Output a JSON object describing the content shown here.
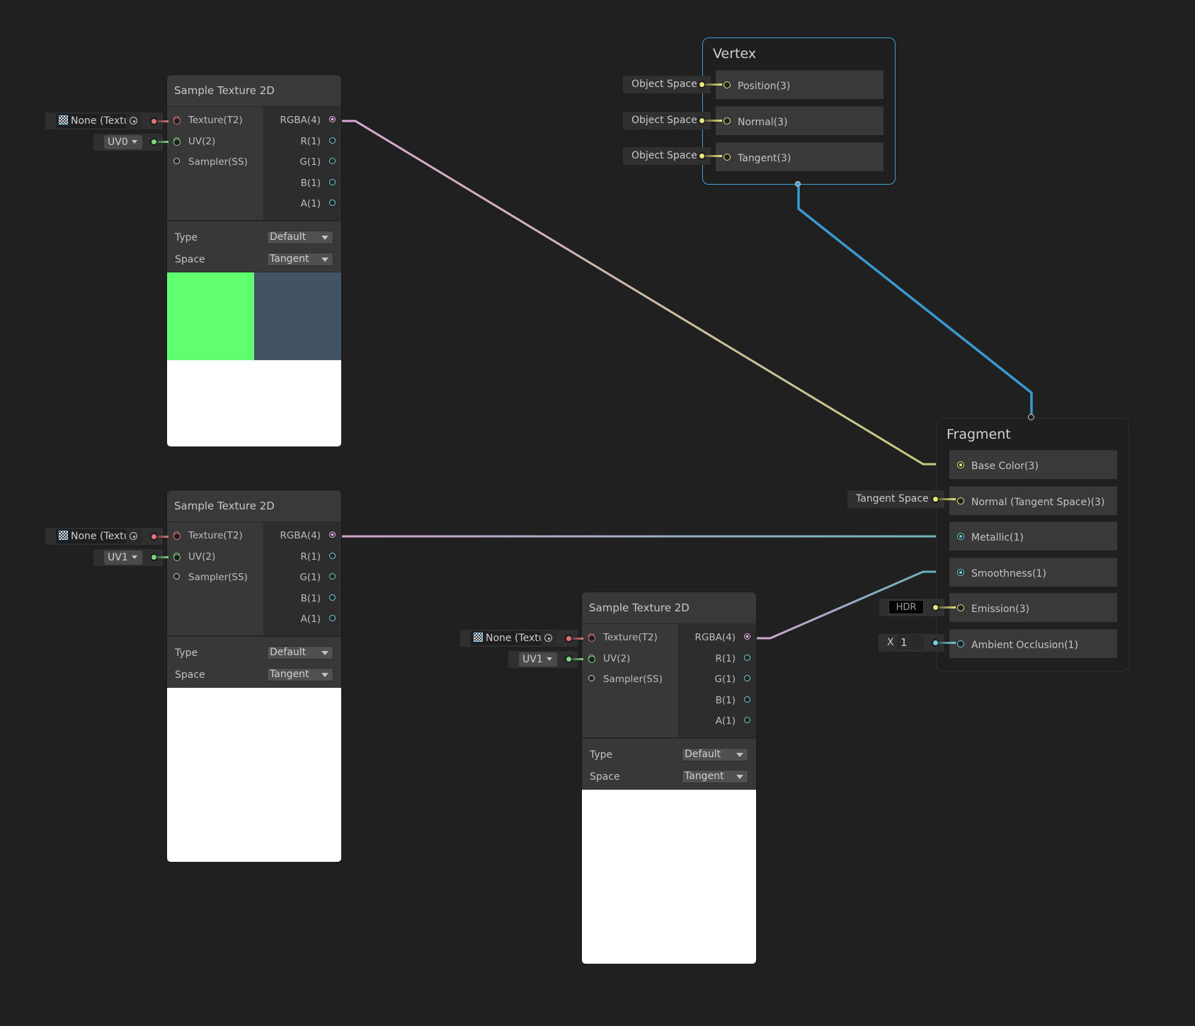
{
  "colors": {
    "background": "#202020",
    "texture_port": "#e27575",
    "uv_port": "#7fd67f",
    "vector4_port": "#f0b5ef",
    "vector1_port": "#6fd1d6",
    "vector3_port": "#e6e77c",
    "vertex_outline": "#3fa0d8",
    "wire_base_color_start": "#d0a8cc",
    "wire_base_color_end": "#c8cc80"
  },
  "sample_nodes": [
    {
      "title": "Sample Texture 2D",
      "inputs": [
        {
          "label": "Texture(T2)",
          "icon": "texture-port"
        },
        {
          "label": "UV(2)",
          "icon": "uv-port"
        },
        {
          "label": "Sampler(SS)",
          "icon": "sampler-port"
        }
      ],
      "outputs": [
        {
          "label": "RGBA(4)"
        },
        {
          "label": "R(1)"
        },
        {
          "label": "G(1)"
        },
        {
          "label": "B(1)"
        },
        {
          "label": "A(1)"
        }
      ],
      "settings": [
        {
          "label": "Type",
          "value": "Default"
        },
        {
          "label": "Space",
          "value": "Tangent"
        }
      ],
      "texture_field": "None (Textu",
      "uv_channel": "UV0",
      "preview": "green-blue-split",
      "preview_colors": [
        "#5fff70",
        "#425363"
      ]
    },
    {
      "title": "Sample Texture 2D",
      "inputs": [
        {
          "label": "Texture(T2)",
          "icon": "texture-port"
        },
        {
          "label": "UV(2)",
          "icon": "uv-port"
        },
        {
          "label": "Sampler(SS)",
          "icon": "sampler-port"
        }
      ],
      "outputs": [
        {
          "label": "RGBA(4)"
        },
        {
          "label": "R(1)"
        },
        {
          "label": "G(1)"
        },
        {
          "label": "B(1)"
        },
        {
          "label": "A(1)"
        }
      ],
      "settings": [
        {
          "label": "Type",
          "value": "Default"
        },
        {
          "label": "Space",
          "value": "Tangent"
        }
      ],
      "texture_field": "None (Textu",
      "uv_channel": "UV1",
      "preview": "white"
    },
    {
      "title": "Sample Texture 2D",
      "inputs": [
        {
          "label": "Texture(T2)",
          "icon": "texture-port"
        },
        {
          "label": "UV(2)",
          "icon": "uv-port"
        },
        {
          "label": "Sampler(SS)",
          "icon": "sampler-port"
        }
      ],
      "outputs": [
        {
          "label": "RGBA(4)"
        },
        {
          "label": "R(1)"
        },
        {
          "label": "G(1)"
        },
        {
          "label": "B(1)"
        },
        {
          "label": "A(1)"
        }
      ],
      "settings": [
        {
          "label": "Type",
          "value": "Default"
        },
        {
          "label": "Space",
          "value": "Tangent"
        }
      ],
      "texture_field": "None (Textu",
      "uv_channel": "UV1",
      "preview": "white"
    }
  ],
  "vertex": {
    "title": "Vertex",
    "slots": [
      {
        "label": "Position(3)",
        "default": "Object Space"
      },
      {
        "label": "Normal(3)",
        "default": "Object Space"
      },
      {
        "label": "Tangent(3)",
        "default": "Object Space"
      }
    ]
  },
  "fragment": {
    "title": "Fragment",
    "slots": [
      {
        "label": "Base Color(3)",
        "connected": true,
        "type": "vector3"
      },
      {
        "label": "Normal (Tangent Space)(3)",
        "connected": false,
        "type": "vector3",
        "default": "Tangent Space"
      },
      {
        "label": "Metallic(1)",
        "connected": true,
        "type": "vector1"
      },
      {
        "label": "Smoothness(1)",
        "connected": true,
        "type": "vector1"
      },
      {
        "label": "Emission(3)",
        "connected": false,
        "type": "vector3",
        "default": "HDR"
      },
      {
        "label": "Ambient Occlusion(1)",
        "connected": false,
        "type": "vector1",
        "default_axis": "X",
        "default_value": "1"
      }
    ]
  },
  "connections": [
    {
      "from": "sample_nodes.0.RGBA(4)",
      "to": "fragment.Base Color(3)"
    },
    {
      "from": "sample_nodes.1.RGBA(4)",
      "to": "fragment.Metallic(1)"
    },
    {
      "from": "sample_nodes.2.RGBA(4)",
      "to": "fragment.Smoothness(1)"
    },
    {
      "from": "vertex",
      "to": "fragment"
    }
  ]
}
